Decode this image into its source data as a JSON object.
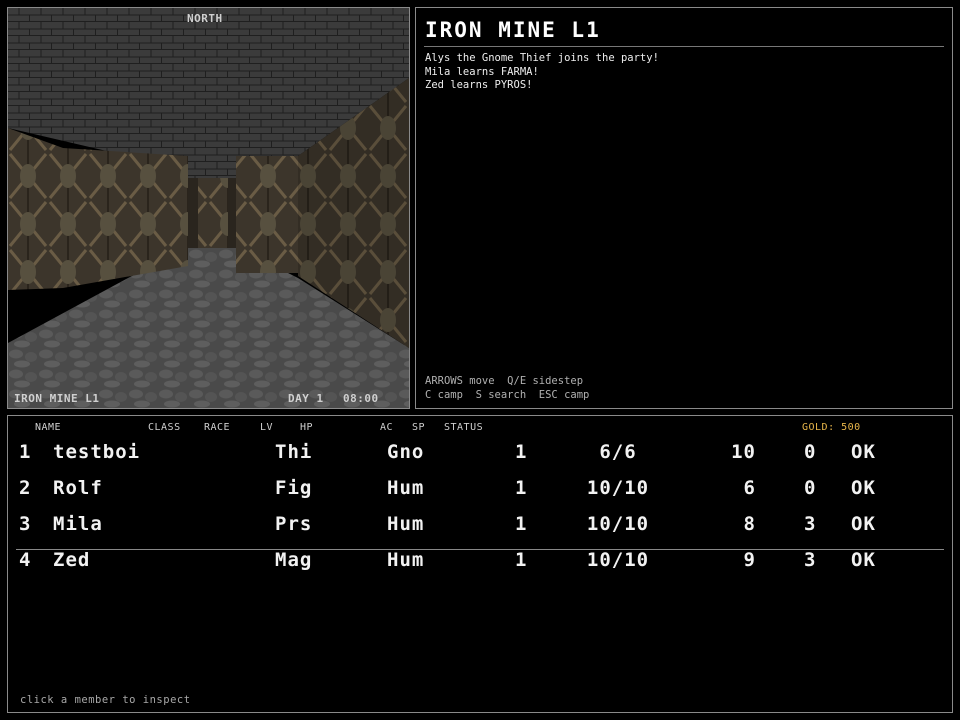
{
  "viewport": {
    "compass": "NORTH",
    "location": "IRON MINE L1",
    "day_label": "DAY 1",
    "time": "08:00"
  },
  "log": {
    "title": "IRON MINE L1",
    "messages": [
      "Alys the Gnome Thief joins the party!",
      "Mila learns FARMA!",
      "Zed learns PYROS!"
    ],
    "help_line1": "ARROWS move  Q/E sidestep",
    "help_line2": "C camp  S search  ESC camp"
  },
  "party": {
    "headers": {
      "name": "NAME",
      "class": "CLASS",
      "race": "RACE",
      "lv": "LV",
      "hp": "HP",
      "ac": "AC",
      "sp": "SP",
      "status": "STATUS"
    },
    "gold_label": "GOLD:",
    "gold_value": "500",
    "members": [
      {
        "num": "1",
        "name": "testboi",
        "class": "Thi",
        "race": "Gno",
        "lv": "1",
        "hp": "6/6",
        "ac": "10",
        "sp": "0",
        "status": "OK"
      },
      {
        "num": "2",
        "name": "Rolf",
        "class": "Fig",
        "race": "Hum",
        "lv": "1",
        "hp": "10/10",
        "ac": "6",
        "sp": "0",
        "status": "OK"
      },
      {
        "num": "3",
        "name": "Mila",
        "class": "Prs",
        "race": "Hum",
        "lv": "1",
        "hp": "10/10",
        "ac": "8",
        "sp": "3",
        "status": "OK"
      },
      {
        "num": "4",
        "name": "Zed",
        "class": "Mag",
        "race": "Hum",
        "lv": "1",
        "hp": "10/10",
        "ac": "9",
        "sp": "3",
        "status": "OK"
      }
    ],
    "hint": "click a member to inspect"
  },
  "colors": {
    "gold": "#e8b64a",
    "border": "#8a8a8a",
    "background": "#000000"
  }
}
